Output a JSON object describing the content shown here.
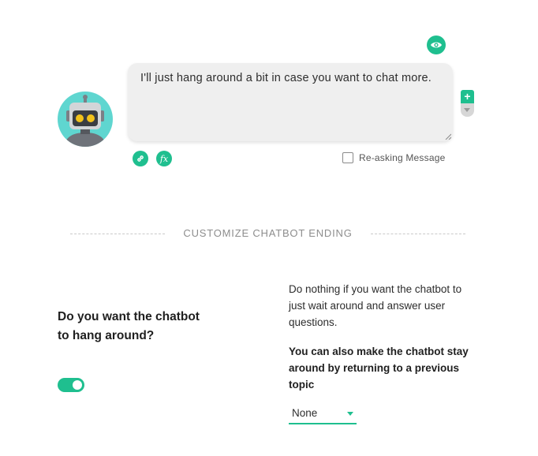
{
  "message": {
    "text": "I'll just hang around a bit in case you want to chat more."
  },
  "icons": {
    "preview": "eye-icon",
    "avatar": "robot-avatar-icon",
    "add": "plus-icon",
    "move_down": "chevron-down-icon",
    "link": "link-icon",
    "function": "fx-icon"
  },
  "controls": {
    "add_label": "+",
    "fx_label": "fx",
    "reasking_label": "Re-asking Message"
  },
  "section": {
    "title": "CUSTOMIZE CHATBOT ENDING"
  },
  "hangaround": {
    "question": "Do you want the chatbot to hang around?",
    "toggle_on": true,
    "description": "Do nothing if you want the chatbot to just wait around and answer user questions.",
    "return_label": "You can also make the chatbot stay around by returning to a previous topic",
    "topic_select": {
      "value": "None"
    }
  },
  "colors": {
    "accent": "#1fbf8f",
    "avatar_bg": "#5fd6d0",
    "bubble_bg": "#efefef"
  }
}
